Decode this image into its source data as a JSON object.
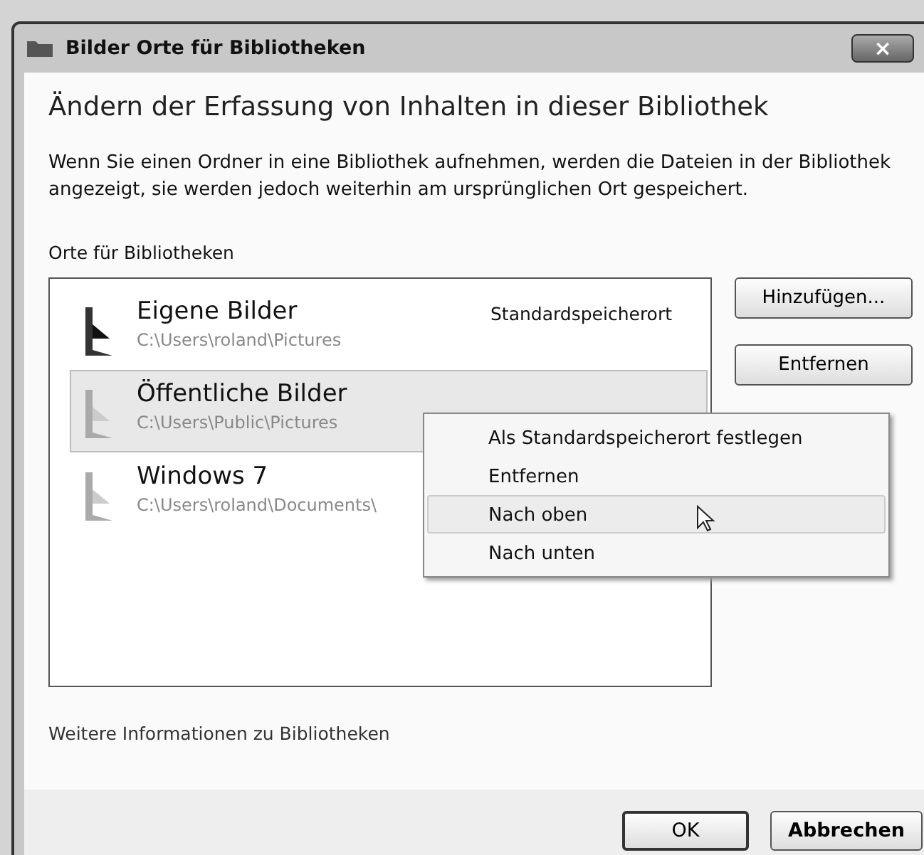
{
  "window": {
    "title": "Bilder Orte für Bibliotheken",
    "close": "×"
  },
  "heading": "Ändern der Erfassung von Inhalten in dieser Bibliothek",
  "description": "Wenn Sie einen Ordner in eine Bibliothek aufnehmen, werden die Dateien in der Bibliothek angezeigt, sie werden jedoch weiterhin am ursprünglichen Ort gespeichert.",
  "locations_label": "Orte für Bibliotheken",
  "locations": [
    {
      "name": "Eigene Bilder",
      "path": "C:\\Users\\roland\\Pictures",
      "note": "Standardspeicherort",
      "selected": false
    },
    {
      "name": "Öffentliche Bilder",
      "path": "C:\\Users\\Public\\Pictures",
      "selected": true
    },
    {
      "name": "Windows 7",
      "path": "C:\\Users\\roland\\Documents\\",
      "selected": false
    }
  ],
  "side_buttons": [
    "Hinzufügen...",
    "Entfernen"
  ],
  "context_menu": [
    {
      "label": "Als Standardspeicherort festlegen",
      "selected": false
    },
    {
      "label": "Entfernen",
      "selected": false
    },
    {
      "label": "Nach oben",
      "selected": true
    },
    {
      "label": "Nach unten",
      "selected": false
    }
  ],
  "more_info_link": "Weitere Informationen zu Bibliotheken",
  "buttons": [
    {
      "label": "OK",
      "kind": "default"
    },
    {
      "label": "Abbrechen",
      "kind": "normal"
    }
  ]
}
